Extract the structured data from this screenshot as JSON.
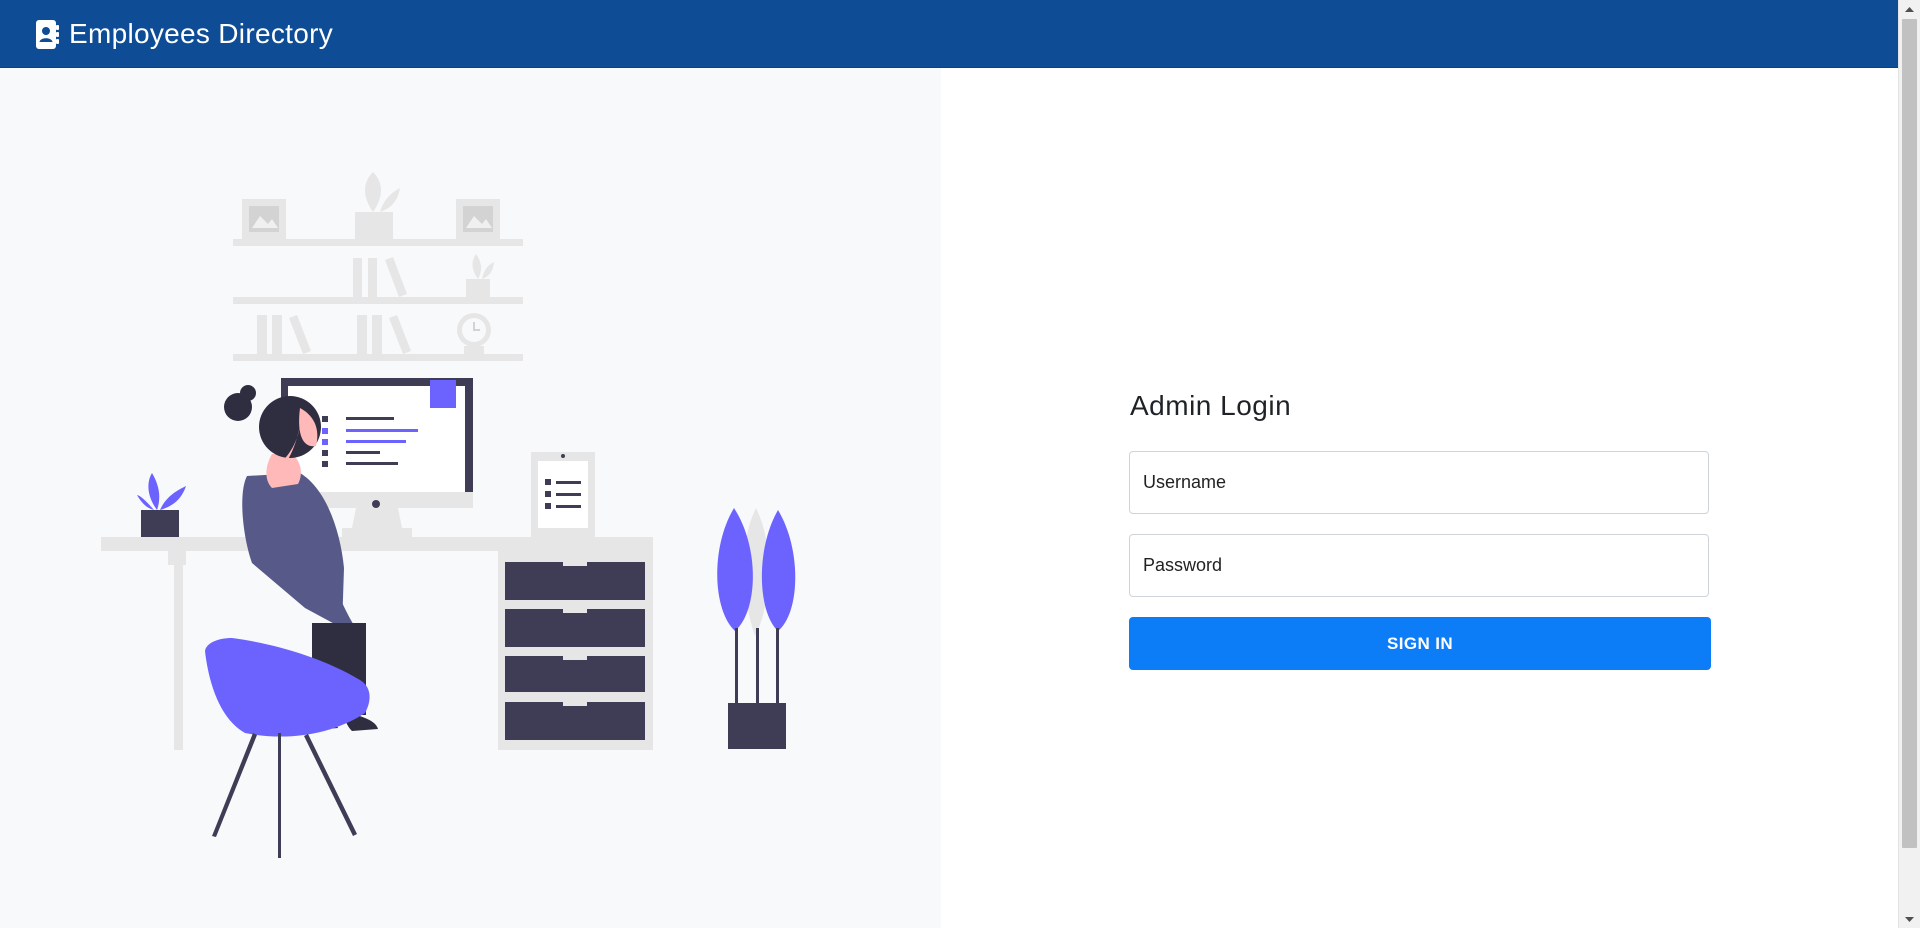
{
  "navbar": {
    "brand_title": "Employees Directory",
    "brand_icon": "address-book-icon",
    "background_color": "#0e4d95"
  },
  "login": {
    "title": "Admin Login",
    "username_placeholder": "Username",
    "password_placeholder": "Password",
    "submit_label": "SIGN IN",
    "button_color": "#0d7cf7"
  },
  "illustration": {
    "name": "woman-working-at-desk",
    "accent_color": "#6c63ff"
  }
}
